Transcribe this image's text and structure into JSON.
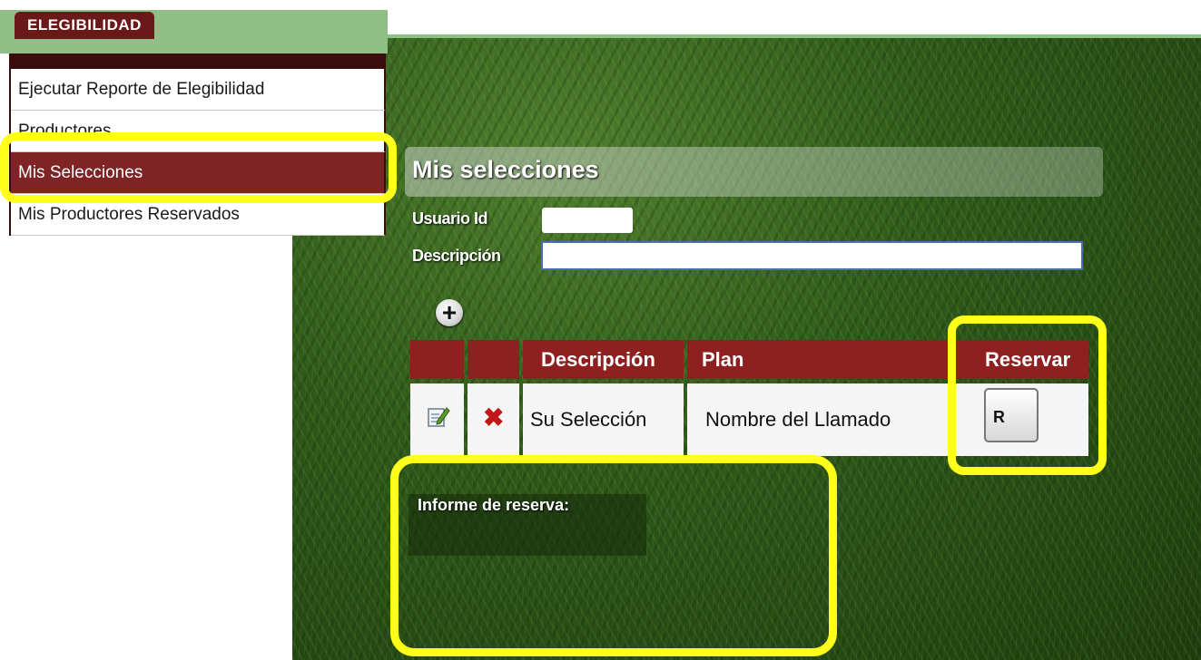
{
  "menu": {
    "tab_label": "ELEGIBILIDAD",
    "items": [
      {
        "label": "Ejecutar Reporte de Elegibilidad"
      },
      {
        "label": "Productores"
      },
      {
        "label": "Mis Selecciones"
      },
      {
        "label": "Mis Productores Reservados"
      }
    ],
    "active_index": 2
  },
  "form": {
    "title": "Mis selecciones",
    "usuario_label": "Usuario Id",
    "usuario_value": "",
    "descripcion_label": "Descripción",
    "descripcion_value": "",
    "add_icon": "+"
  },
  "table": {
    "columns": [
      "",
      "",
      "Descripción",
      "Plan",
      "Reservar"
    ],
    "rows": [
      {
        "edit_icon": "edit-icon",
        "delete_icon": "✖",
        "descripcion": "Su Selección",
        "plan": "Nombre del Llamado",
        "reservar_button": "R"
      }
    ]
  },
  "informe": {
    "label": "Informe de reserva:"
  },
  "colors": {
    "accent": "#8e2020",
    "highlight": "#ffff1a",
    "menu_header": "#8fbf87"
  }
}
